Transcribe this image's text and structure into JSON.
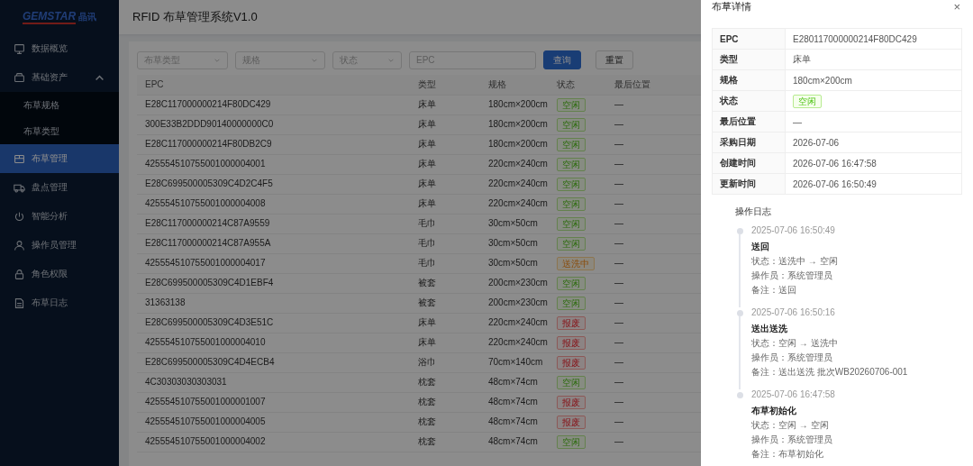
{
  "sidebar": {
    "logo": {
      "brand": "GEMSTAR",
      "suffix": "晶讯"
    },
    "items": [
      {
        "label": "数据概览",
        "kind": "monitor",
        "selected": false
      },
      {
        "label": "基础资产",
        "kind": "box",
        "selected": false,
        "expanded": true,
        "children": [
          {
            "label": "布草规格",
            "selected": false
          },
          {
            "label": "布草类型",
            "selected": false
          }
        ]
      },
      {
        "label": "布草管理",
        "kind": "package",
        "selected": true
      },
      {
        "label": "盘点管理",
        "kind": "truck",
        "selected": false
      },
      {
        "label": "智能分析",
        "kind": "power",
        "selected": false
      },
      {
        "label": "操作员管理",
        "kind": "user",
        "selected": false
      },
      {
        "label": "角色权限",
        "kind": "lock",
        "selected": false
      },
      {
        "label": "布草日志",
        "kind": "doc",
        "selected": false
      }
    ]
  },
  "header": {
    "title": "RFID 布草管理系统V1.0"
  },
  "filters": {
    "selects": [
      {
        "placeholder": "布草类型"
      },
      {
        "placeholder": "规格"
      },
      {
        "placeholder": "状态"
      }
    ],
    "epc": {
      "placeholder": "EPC"
    },
    "buttons": [
      {
        "label": "查询",
        "kind": "primary"
      },
      {
        "label": "重置",
        "kind": "default"
      }
    ]
  },
  "table": {
    "columns": [
      "EPC",
      "类型",
      "规格",
      "状态",
      "最后位置"
    ],
    "rows": [
      {
        "epc": "E28C117000000214F80DC429",
        "type": "床单",
        "spec": "180cm×200cm",
        "status": {
          "label": "空闲",
          "kind": "idle"
        },
        "location": "—"
      },
      {
        "epc": "300E33B2DDD90140000000C0",
        "type": "床单",
        "spec": "180cm×200cm",
        "status": {
          "label": "空闲",
          "kind": "idle"
        },
        "location": "—"
      },
      {
        "epc": "E28C117000000214F80DB2C9",
        "type": "床单",
        "spec": "180cm×200cm",
        "status": {
          "label": "空闲",
          "kind": "idle"
        },
        "location": "—"
      },
      {
        "epc": "425554510755001000004001",
        "type": "床单",
        "spec": "220cm×240cm",
        "status": {
          "label": "空闲",
          "kind": "idle"
        },
        "location": "—"
      },
      {
        "epc": "E28C699500005309C4D2C4F5",
        "type": "床单",
        "spec": "220cm×240cm",
        "status": {
          "label": "空闲",
          "kind": "idle"
        },
        "location": "—"
      },
      {
        "epc": "425554510755001000004008",
        "type": "床单",
        "spec": "220cm×240cm",
        "status": {
          "label": "空闲",
          "kind": "idle"
        },
        "location": "—"
      },
      {
        "epc": "E28C117000000214C87A9559",
        "type": "毛巾",
        "spec": "30cm×50cm",
        "status": {
          "label": "空闲",
          "kind": "idle"
        },
        "location": "—"
      },
      {
        "epc": "E28C117000000214C87A955A",
        "type": "毛巾",
        "spec": "30cm×50cm",
        "status": {
          "label": "空闲",
          "kind": "idle"
        },
        "location": "—"
      },
      {
        "epc": "425554510755001000004017",
        "type": "毛巾",
        "spec": "30cm×50cm",
        "status": {
          "label": "送洗中",
          "kind": "washing"
        },
        "location": "—"
      },
      {
        "epc": "E28C699500005309C4D1EBF4",
        "type": "被套",
        "spec": "200cm×230cm",
        "status": {
          "label": "空闲",
          "kind": "idle"
        },
        "location": "—"
      },
      {
        "epc": "31363138",
        "type": "被套",
        "spec": "200cm×230cm",
        "status": {
          "label": "空闲",
          "kind": "idle"
        },
        "location": "—"
      },
      {
        "epc": "E28C699500005309C4D3E51C",
        "type": "床单",
        "spec": "220cm×240cm",
        "status": {
          "label": "报废",
          "kind": "scrapped"
        },
        "location": "—"
      },
      {
        "epc": "425554510755001000004010",
        "type": "床单",
        "spec": "220cm×240cm",
        "status": {
          "label": "报废",
          "kind": "scrapped"
        },
        "location": "—"
      },
      {
        "epc": "E28C699500005309C4D4ECB4",
        "type": "浴巾",
        "spec": "70cm×140cm",
        "status": {
          "label": "报废",
          "kind": "scrapped"
        },
        "location": "—"
      },
      {
        "epc": "4C30303030303031",
        "type": "枕套",
        "spec": "48cm×74cm",
        "status": {
          "label": "空闲",
          "kind": "idle"
        },
        "location": "—"
      },
      {
        "epc": "425554510755001000001007",
        "type": "枕套",
        "spec": "48cm×74cm",
        "status": {
          "label": "报废",
          "kind": "scrapped"
        },
        "location": "—"
      },
      {
        "epc": "425554510755001000004005",
        "type": "枕套",
        "spec": "48cm×74cm",
        "status": {
          "label": "报废",
          "kind": "scrapped"
        },
        "location": "—"
      },
      {
        "epc": "425554510755001000004002",
        "type": "枕套",
        "spec": "48cm×74cm",
        "status": {
          "label": "空闲",
          "kind": "idle"
        },
        "location": "—"
      }
    ]
  },
  "drawer": {
    "title": "布草详情",
    "close": "×",
    "details": [
      {
        "label": "EPC",
        "value": "E280117000000214F80DC429",
        "kind": "text"
      },
      {
        "label": "类型",
        "value": "床单",
        "kind": "text"
      },
      {
        "label": "规格",
        "value": "180cm×200cm",
        "kind": "text"
      },
      {
        "label": "状态",
        "value": "空闲",
        "kind": "idle"
      },
      {
        "label": "最后位置",
        "value": "—",
        "kind": "text"
      },
      {
        "label": "采购日期",
        "value": "2026-07-06",
        "kind": "text"
      },
      {
        "label": "创建时间",
        "value": "2026-07-06 16:47:58",
        "kind": "text"
      },
      {
        "label": "更新时间",
        "value": "2026-07-06 16:50:49",
        "kind": "text"
      }
    ],
    "log_title": "操作日志",
    "log": [
      {
        "time": "2025-07-06 16:50:49",
        "action": "送回",
        "lines": [
          "状态：送洗中 → 空闲",
          "操作员：系统管理员",
          "备注：送回"
        ]
      },
      {
        "time": "2025-07-06 16:50:16",
        "action": "送出送洗",
        "lines": [
          "状态：空闲 → 送洗中",
          "操作员：系统管理员",
          "备注：送出送洗 批次WB20260706-001"
        ]
      },
      {
        "time": "2025-07-06 16:47:58",
        "action": "布草初始化",
        "lines": [
          "状态：空闲 → 空闲",
          "操作员：系统管理员",
          "备注：布草初始化"
        ]
      }
    ]
  }
}
